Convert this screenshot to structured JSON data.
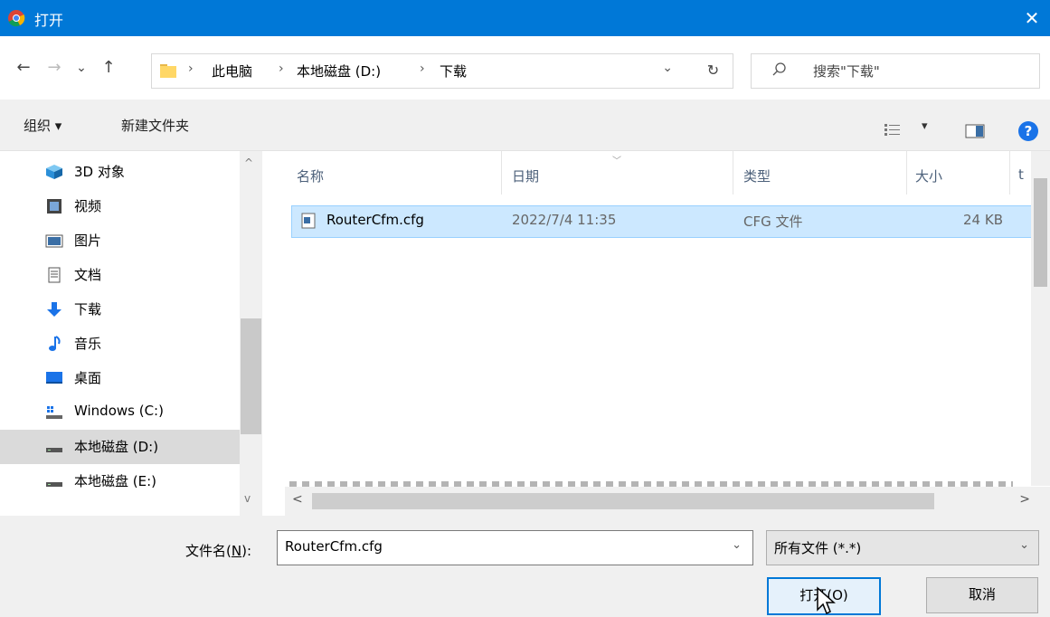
{
  "window": {
    "title": "打开",
    "close_glyph": "✕"
  },
  "nav": {
    "back": "←",
    "forward": "→",
    "recent": "⌄",
    "up": "↑",
    "breadcrumbs": [
      "此电脑",
      "本地磁盘 (D:)",
      "下载"
    ],
    "separator": "›",
    "dropdown": "⌄",
    "refresh": "↻",
    "search_placeholder": "搜索\"下载\""
  },
  "toolbar": {
    "organize": "组织 ▾",
    "new_folder": "新建文件夹",
    "view_arrow": "▾",
    "help": "?"
  },
  "sidebar": {
    "items": [
      {
        "label": "3D 对象",
        "icon": "cube-icon",
        "color": "#2b8fd8"
      },
      {
        "label": "视频",
        "icon": "video-icon",
        "color": "#444444"
      },
      {
        "label": "图片",
        "icon": "pictures-icon",
        "color": "#3a6ea5"
      },
      {
        "label": "文档",
        "icon": "document-icon",
        "color": "#555555"
      },
      {
        "label": "下载",
        "icon": "download-arrow-icon",
        "color": "#1a73e8"
      },
      {
        "label": "音乐",
        "icon": "music-note-icon",
        "color": "#1a73e8"
      },
      {
        "label": "桌面",
        "icon": "desktop-icon",
        "color": "#1a73e8"
      },
      {
        "label": "Windows (C:)",
        "icon": "windows-drive-icon",
        "color": "#555555"
      },
      {
        "label": "本地磁盘 (D:)",
        "icon": "drive-icon",
        "color": "#555555",
        "selected": true
      },
      {
        "label": "本地磁盘 (E:)",
        "icon": "drive-icon",
        "color": "#555555"
      }
    ],
    "scroll_up": "^",
    "scroll_down": "v"
  },
  "files": {
    "columns": {
      "name": "名称",
      "date": "日期",
      "type": "类型",
      "size": "大小",
      "extra": "t"
    },
    "rows": [
      {
        "name": "RouterCfm.cfg",
        "date": "2022/7/4 11:35",
        "type": "CFG 文件",
        "size": "24 KB"
      }
    ],
    "hscroll_left": "<",
    "hscroll_right": ">"
  },
  "bottom": {
    "filename_label_prefix": "文件名(",
    "filename_label_hotkey": "N",
    "filename_label_suffix": "):",
    "filename_value": "RouterCfm.cfg",
    "filter_value": "所有文件 (*.*)",
    "dropdown": "⌄",
    "open_button": "打开(O)",
    "cancel_button": "取消"
  },
  "colors": {
    "titlebar": "#0078d7",
    "selection": "#cce8ff",
    "accent": "#0078d7"
  }
}
